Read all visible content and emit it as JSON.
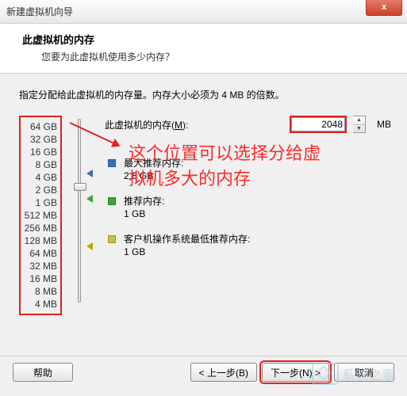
{
  "window": {
    "title": "新建虚拟机向导",
    "close_icon": "x"
  },
  "header": {
    "title": "此虚拟机的内存",
    "subtitle": "您要为此虚拟机使用多少内存？"
  },
  "instruction": "指定分配给此虚拟机的内存量。内存大小必须为 4 MB 的倍数。",
  "memory": {
    "label_prefix": "此虚拟机的内存(",
    "label_hotkey": "M",
    "label_suffix": "):",
    "value": "2048",
    "unit": "MB"
  },
  "scale": [
    "64 GB",
    "32 GB",
    "16 GB",
    "8 GB",
    "4 GB",
    "2 GB",
    "1 GB",
    "512 MB",
    "256 MB",
    "128 MB",
    "64 MB",
    "32 MB",
    "16 MB",
    "8 MB",
    "4 MB"
  ],
  "hints": {
    "max": {
      "label": "最大推荐内存:",
      "value": "2.8 GB"
    },
    "rec": {
      "label": "推荐内存:",
      "value": "1 GB"
    },
    "min": {
      "label": "客户机操作系统最低推荐内存:",
      "value": "1 GB"
    }
  },
  "annotation": {
    "line1": "这个位置可以选择分给虚",
    "line2": "拟机多大的内存"
  },
  "footer": {
    "help": "帮助",
    "back": "< 上一步(B)",
    "next": "下一步(N) >",
    "cancel": "取消"
  },
  "watermark": "系统之家"
}
